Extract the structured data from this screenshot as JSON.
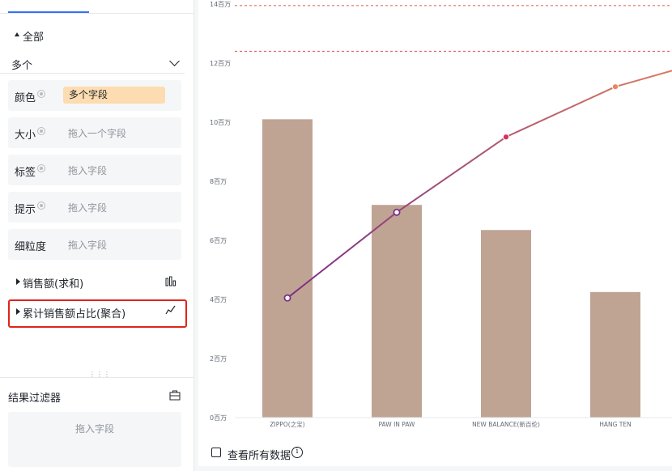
{
  "left_panel": {
    "all_label": "全部",
    "select_value": "多个",
    "fields": [
      {
        "label": "颜色",
        "value": "多个字段"
      },
      {
        "label": "大小",
        "hint": "拖入一个字段"
      },
      {
        "label": "标签",
        "hint": "拖入字段"
      },
      {
        "label": "提示",
        "hint": "拖入字段"
      },
      {
        "label": "细粒度",
        "hint": "拖入字段"
      }
    ],
    "measures": [
      {
        "label": "销售额(求和)",
        "icon": "bar-chart-icon"
      },
      {
        "label": "累计销售额占比(聚合)",
        "icon": "line-chart-icon"
      }
    ],
    "filter": {
      "title": "结果过滤器",
      "drop_hint": "拖入字段"
    }
  },
  "footer": {
    "view_all_label": "查看所有数据"
  },
  "colors": {
    "bar": "#bfa494",
    "line_start": "#7b2f86",
    "line_end": "#e8875a",
    "reference_line": "#e05252",
    "highlight_border": "#e0241c",
    "tab_active": "#3370ff"
  },
  "chart_data": {
    "type": "bar",
    "categories": [
      "ZIPPO(之宝)",
      "PAW IN PAW",
      "NEW BALANCE(新百伦)",
      "HANG TEN"
    ],
    "y_ticks": [
      "0百万",
      "2百万",
      "4百万",
      "6百万",
      "8百万",
      "10百万",
      "12百万",
      "14百万"
    ],
    "ylim": [
      0,
      14
    ],
    "bar_values": [
      10.1,
      7.2,
      6.35,
      4.25
    ],
    "line_values": [
      4.05,
      6.95,
      9.5,
      11.2,
      12.25
    ],
    "reference_lines": [
      12.4,
      13.95
    ],
    "grid": false,
    "legend": "none"
  }
}
